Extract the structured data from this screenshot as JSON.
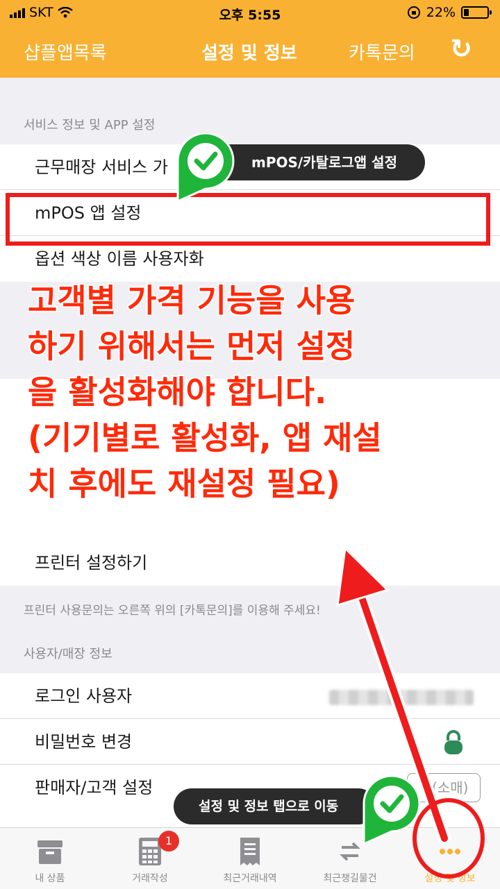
{
  "status_bar": {
    "carrier": "SKT",
    "time": "오후 5:55",
    "battery": "22%",
    "battery_level": 0.22
  },
  "nav": {
    "left": "샵플앱목록",
    "title": "설정 및 정보",
    "right": "카톡문의",
    "refresh": "↻"
  },
  "sections": {
    "service": {
      "header": "서비스 정보 및 APP 설정",
      "rows": [
        "근무매장 서비스 가",
        "mPOS 앱 설정",
        "옵션 색상 이름 사용자화"
      ]
    },
    "printer": {
      "row": "프린터 설정하기",
      "note": "프린터 사용문의는 오른쪽 위의 [카톡문의]를 이용해 주세요!"
    },
    "user": {
      "header": "사용자/매장 정보",
      "rows": [
        "로그인 사용자",
        "비밀번호 변경",
        "판매자/고객 설정"
      ],
      "seg_label": "백(소매)"
    }
  },
  "overlay": {
    "callout_top": "mPOS/카탈로그앱 설정",
    "callout_bottom": "설정 및 정보 탭으로 이동",
    "note_lines": [
      "고객별 가격 기능을 사용",
      "하기 위해서는 먼저 설정",
      "을 활성화해야 합니다.",
      "(기기별로 활성화, 앱 재설",
      "치 후에도 재설정 필요)"
    ],
    "accent": "#ee1c1c",
    "marker_green": "#1fb53a"
  },
  "tabs": [
    {
      "label": "내 상품",
      "icon": "box-icon"
    },
    {
      "label": "거래작성",
      "icon": "calculator-icon",
      "badge": "1"
    },
    {
      "label": "최근거래내역",
      "icon": "receipt-icon"
    },
    {
      "label": "최근챙길물건",
      "icon": "swap-icon"
    },
    {
      "label": "설정 및 정보",
      "icon": "more-icon"
    }
  ],
  "colors": {
    "brand": "#f8b132",
    "lock": "#2e8b57"
  }
}
